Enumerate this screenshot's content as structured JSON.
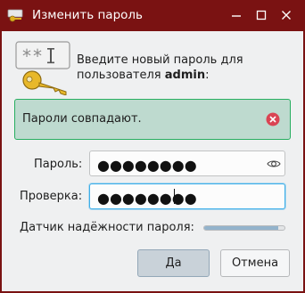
{
  "window": {
    "title": "Изменить пароль",
    "title_bar_color": "#7a1212"
  },
  "titlebar_icons": {
    "app": "keys-app-icon",
    "minimize": "minimize-icon",
    "maximize": "maximize-icon",
    "close": "close-icon"
  },
  "prompt": {
    "line1": "Введите новый пароль для",
    "line2_prefix": "пользователя ",
    "user": "admin",
    "line2_suffix": ":"
  },
  "message": {
    "text": "Пароли совпадают.",
    "border_color": "#27ae60",
    "background": "#bedacf"
  },
  "form": {
    "password_label": "Пароль:",
    "password_value": "●●●●●●●●",
    "verify_label": "Проверка:",
    "verify_value": "●●●●●●●●",
    "strength_label": "Датчик надёжности пароля:",
    "strength_fraction": 0.92
  },
  "buttons": {
    "ok": "Да",
    "cancel": "Отмена"
  }
}
